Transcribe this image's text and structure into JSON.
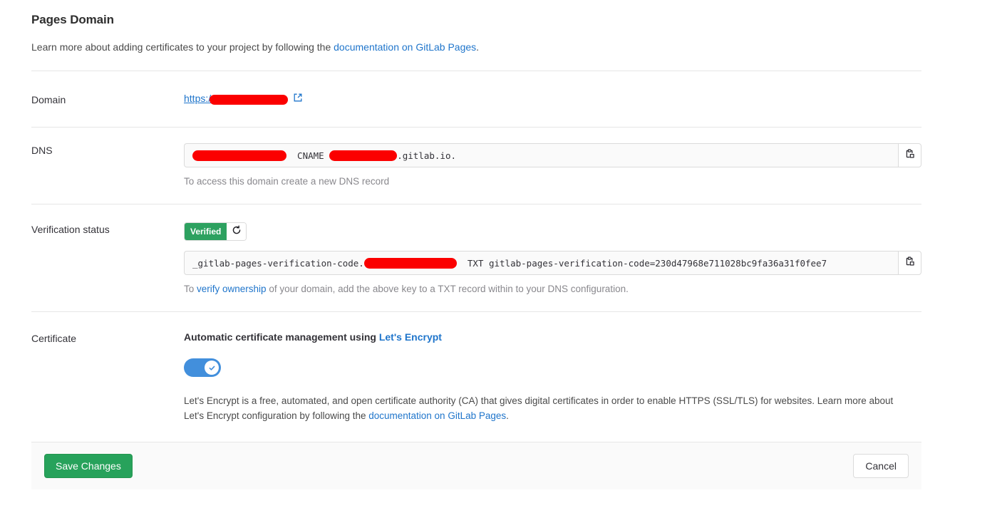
{
  "header": {
    "title": "Pages Domain",
    "subtitle_before": "Learn more about adding certificates to your project by following the ",
    "subtitle_link": "documentation on GitLab Pages",
    "subtitle_after": "."
  },
  "domain": {
    "label": "Domain",
    "scheme_text": "https:/",
    "redacted": true,
    "external_link_icon": "external-link-icon"
  },
  "dns": {
    "label": "DNS",
    "record_type": "CNAME",
    "record_suffix": ".gitlab.io.",
    "help": "To access this domain create a new DNS record",
    "copy_icon": "clipboard-icon"
  },
  "verification": {
    "label": "Verification status",
    "badge": "Verified",
    "badge_color": "#2da160",
    "retry_icon": "refresh-icon",
    "record_prefix": "_gitlab-pages-verification-code.",
    "record_type": "TXT",
    "record_value": "gitlab-pages-verification-code=230d47968e711028bc9fa36a31f0fee7",
    "help_before": "To ",
    "help_link": "verify ownership",
    "help_after": " of your domain, add the above key to a TXT record within to your DNS configuration.",
    "copy_icon": "clipboard-icon"
  },
  "certificate": {
    "label": "Certificate",
    "heading_before": "Automatic certificate management using ",
    "heading_link": "Let's Encrypt",
    "toggle_on": true,
    "toggle_color": "#428fdc",
    "description_before": "Let's Encrypt is a free, automated, and open certificate authority (CA) that gives digital certificates in order to enable HTTPS (SSL/TLS) for websites. Learn more about Let's Encrypt configuration by following the ",
    "description_link": "documentation on GitLab Pages",
    "description_after": "."
  },
  "footer": {
    "save_label": "Save Changes",
    "cancel_label": "Cancel",
    "save_color": "#27a25b"
  }
}
